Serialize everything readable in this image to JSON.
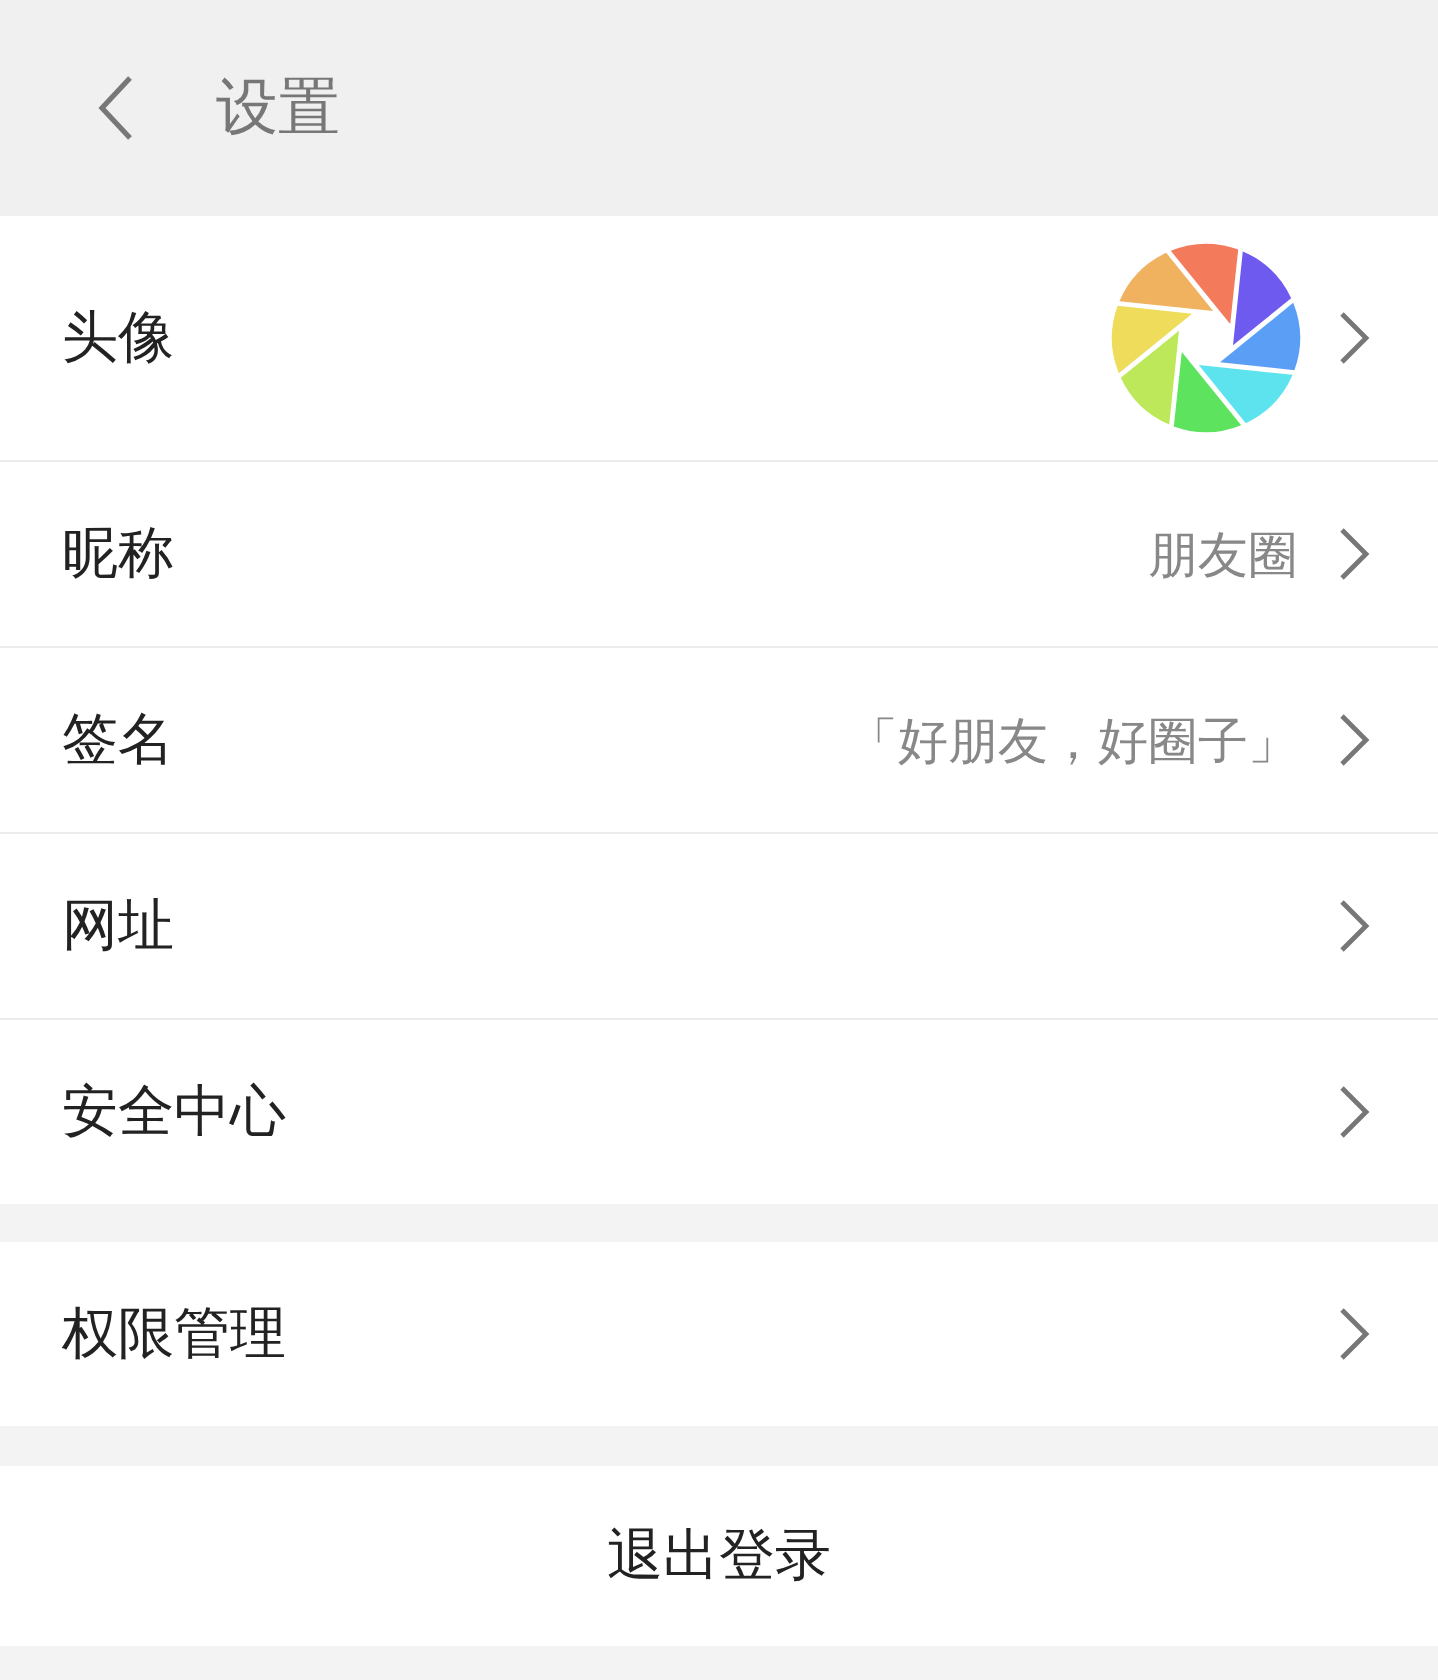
{
  "header": {
    "title": "设置"
  },
  "groups": [
    {
      "items": [
        {
          "kind": "avatar",
          "label": "头像"
        },
        {
          "kind": "text",
          "label": "昵称",
          "value": "朋友圈"
        },
        {
          "kind": "text",
          "label": "签名",
          "value": "「好朋友，好圈子」"
        },
        {
          "kind": "text",
          "label": "网址"
        },
        {
          "kind": "text",
          "label": "安全中心"
        }
      ]
    },
    {
      "items": [
        {
          "kind": "text",
          "label": "权限管理"
        }
      ]
    }
  ],
  "logout_button": "退出登录"
}
